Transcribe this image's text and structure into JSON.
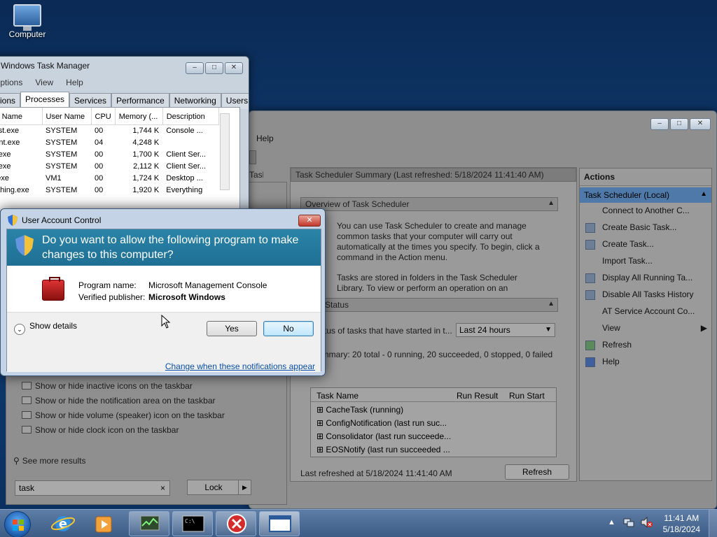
{
  "desktop": {
    "icon_label": "Computer"
  },
  "task_manager": {
    "title": "Windows Task Manager",
    "menu": [
      "Options",
      "View",
      "Help"
    ],
    "tabs": [
      "Applications",
      "Processes",
      "Services",
      "Performance",
      "Networking",
      "Users"
    ],
    "columns": [
      "Image Name",
      "User Name",
      "CPU",
      "Memory (...",
      "Description"
    ],
    "rows": [
      [
        "svchost.exe",
        "SYSTEM",
        "00",
        "1,744 K",
        "Console ..."
      ],
      [
        "consent.exe",
        "SYSTEM",
        "04",
        "4,248 K",
        ""
      ],
      [
        "csrss.exe",
        "SYSTEM",
        "00",
        "1,700 K",
        "Client Ser..."
      ],
      [
        "csrss.exe",
        "SYSTEM",
        "00",
        "2,112 K",
        "Client Ser..."
      ],
      [
        "dwm.exe",
        "VM1",
        "00",
        "1,724 K",
        "Desktop ..."
      ],
      [
        "Everything.exe",
        "SYSTEM",
        "00",
        "1,920 K",
        "Everything"
      ]
    ]
  },
  "task_scheduler": {
    "menu_help": "Help",
    "tree_root": "Task Scheduler (Local)",
    "summary_header": "Task Scheduler Summary (Last refreshed: 5/18/2024 11:41:40 AM)",
    "overview_header": "Overview of Task Scheduler",
    "overview_text": "You can use Task Scheduler to create and manage common tasks that your computer will carry out automatically at the times you specify. To begin, click a command in the Action menu.",
    "overview_text2": "Tasks are stored in folders in the Task Scheduler Library. To view or perform an operation on an",
    "status_header": "Task Status",
    "status_label": "Status of tasks that have started in t...",
    "status_range": "Last 24 hours",
    "summary_line": "Summary: 20 total - 0 running, 20 succeeded, 0 stopped, 0 failed",
    "task_columns": [
      "Task Name",
      "Run Result",
      "Run Start"
    ],
    "tasks": [
      "CacheTask (running)",
      "ConfigNotification (last run suc...",
      "Consolidator (last run succeede...",
      "EOSNotify (last run succeeded ..."
    ],
    "last_refreshed": "Last refreshed at 5/18/2024 11:41:40 AM",
    "refresh_button": "Refresh"
  },
  "actions_pane": {
    "header": "Actions",
    "selected": "Task Scheduler (Local)",
    "items": [
      "Connect to Another C...",
      "Create Basic Task...",
      "Create Task...",
      "Import Task...",
      "Display All Running Ta...",
      "Disable All Tasks History",
      "AT Service Account Co...",
      "View",
      "Refresh",
      "Help"
    ]
  },
  "control_panel_search": {
    "items": [
      "Show or hide inactive icons on the taskbar",
      "Show or hide the notification area on the taskbar",
      "Show or hide volume (speaker) icon on the taskbar",
      "Show or hide clock icon on the taskbar"
    ],
    "see_more": "See more results",
    "search_value": "task",
    "lock_label": "Lock"
  },
  "uac": {
    "title": "User Account Control",
    "heading": "Do you want to allow the following program to make changes to this computer?",
    "program_label": "Program name:",
    "program_value": "Microsoft Management Console",
    "publisher_label": "Verified publisher:",
    "publisher_value": "Microsoft Windows",
    "show_details": "Show details",
    "yes": "Yes",
    "no": "No",
    "change_link": "Change when these notifications appear"
  },
  "taskbar": {
    "time": "11:41 AM",
    "date": "5/18/2024"
  }
}
